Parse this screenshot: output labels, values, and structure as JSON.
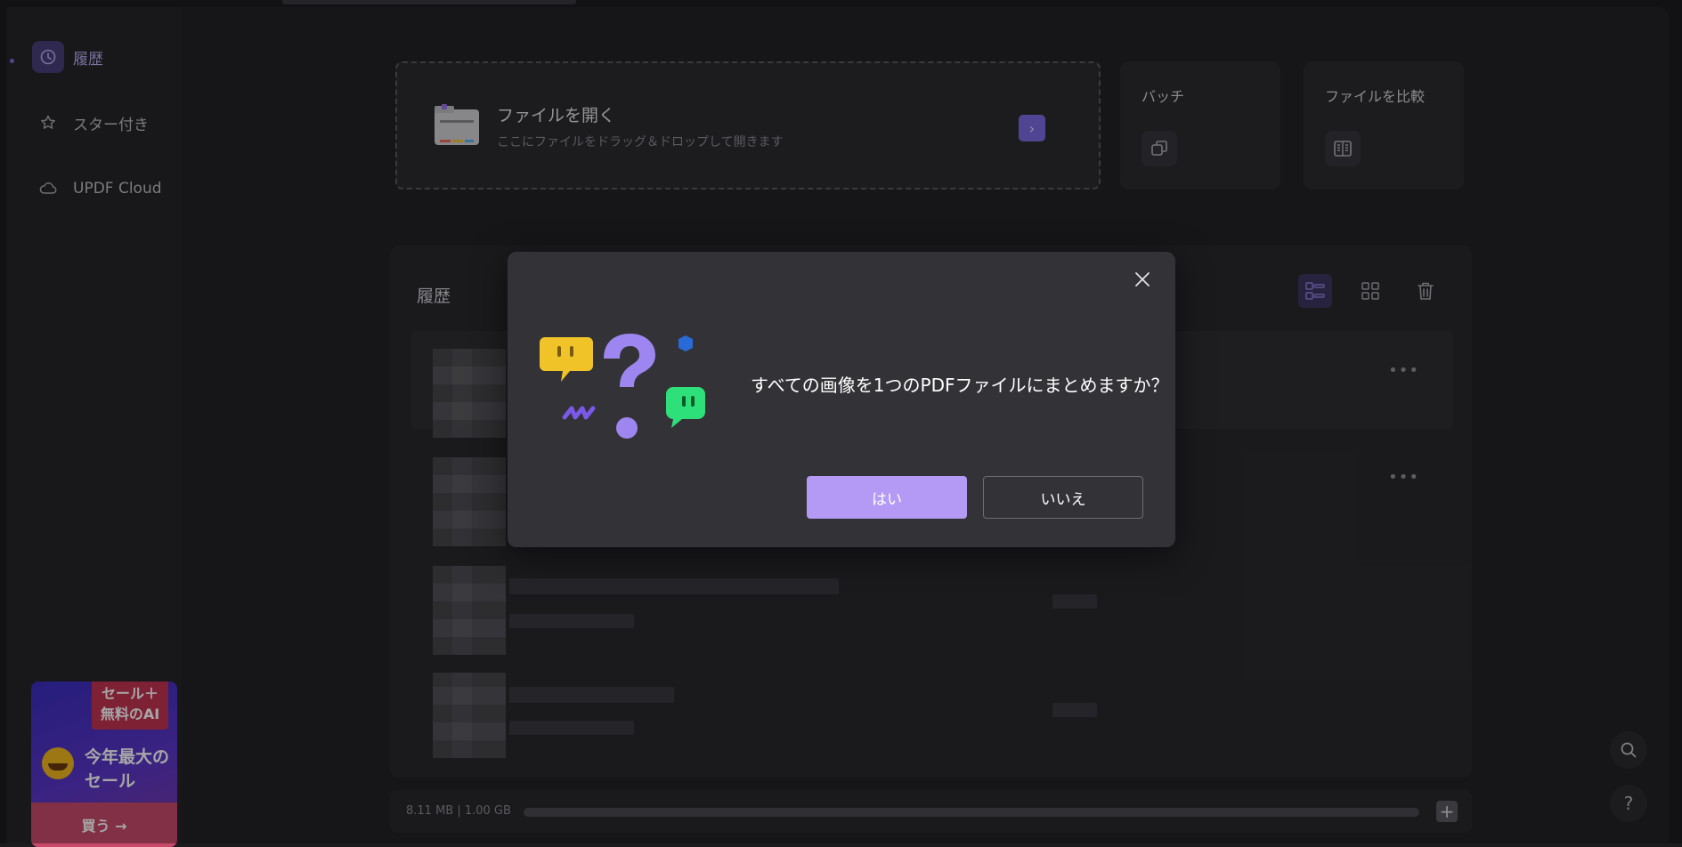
{
  "sidebar": {
    "items": [
      {
        "label": "履歴",
        "icon": "clock-icon",
        "active": true
      },
      {
        "label": "スター付き",
        "icon": "star-icon",
        "active": false
      },
      {
        "label": "UPDF Cloud",
        "icon": "cloud-icon",
        "active": false
      }
    ],
    "promo": {
      "tag": "セール＋\n無料のAI",
      "headline": "今年最大の\nセール",
      "buy_label": "買う →"
    }
  },
  "open_file": {
    "title": "ファイルを開く",
    "subtitle": "ここにファイルをドラッグ＆ドロップして開きます"
  },
  "tools": [
    {
      "label": "バッチ",
      "icon": "batch-icon"
    },
    {
      "label": "ファイルを比較",
      "icon": "compare-icon"
    }
  ],
  "history": {
    "title": "履歴"
  },
  "footer": {
    "storage": "8.11 MB | 1.00 GB"
  },
  "dialog": {
    "message": "すべての画像を1つのPDFファイルにまとめますか？",
    "yes_label": "はい",
    "no_label": "いいえ"
  },
  "colors": {
    "accent": "#b49af4",
    "brand_purple": "#7a6ae0",
    "dialog_bg": "#333337"
  }
}
